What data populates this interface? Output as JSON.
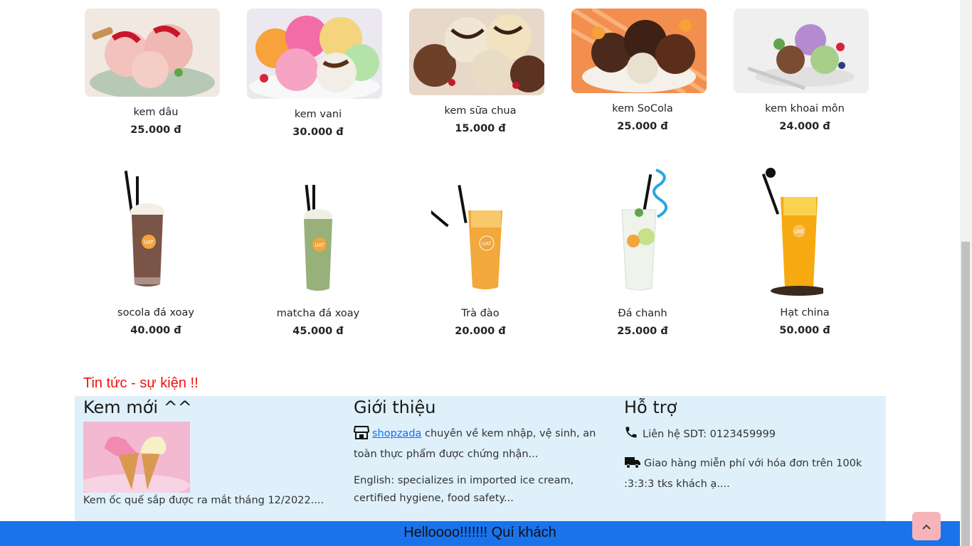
{
  "ice_creams": [
    {
      "name": "kem dâu",
      "price": "25.000 đ"
    },
    {
      "name": "kem vani",
      "price": "30.000 đ"
    },
    {
      "name": "kem sữa chua",
      "price": "15.000 đ"
    },
    {
      "name": "kem SoCola",
      "price": "25.000 đ"
    },
    {
      "name": "kem khoai môn",
      "price": "24.000 đ"
    }
  ],
  "drinks": [
    {
      "name": "socola đá xoay",
      "price": "40.000 đ"
    },
    {
      "name": "matcha đá xoay",
      "price": "45.000 đ"
    },
    {
      "name": "Trà đào",
      "price": "20.000 đ"
    },
    {
      "name": "Đá chanh",
      "price": "25.000 đ"
    },
    {
      "name": "Hạt china",
      "price": "50.000 đ"
    }
  ],
  "news": {
    "title": "Tin tức - sự kiện !!"
  },
  "footer": {
    "new_item": {
      "heading": "Kem mới ^^",
      "caption": "Kem ốc quế sắp được ra mắt tháng 12/2022...."
    },
    "about": {
      "heading": "Giới thiệu",
      "link": "shopzada",
      "text1": " chuyên về kem nhập, vệ sinh, an toàn thực phẩm được chứng nhận...",
      "text2": "English: specializes in imported ice cream, certified hygiene, food safety..."
    },
    "support": {
      "heading": "Hỗ trợ",
      "phone": "Liên hệ SDT: 0123459999",
      "delivery": "Giao hàng miễn phí với hóa đơn trên 100k :3:3:3 tks khách ạ...."
    }
  },
  "bottom_bar": {
    "text": "Helloooo!!!!!!! Quí khách"
  },
  "colors": {
    "accent": "#1b73ec",
    "news_red": "#ee1111",
    "footer_bg": "#dff0fb",
    "top_button": "#f6b3ba"
  },
  "icons": [
    "shop-icon",
    "phone-icon",
    "truck-icon",
    "chevron-up-icon"
  ]
}
